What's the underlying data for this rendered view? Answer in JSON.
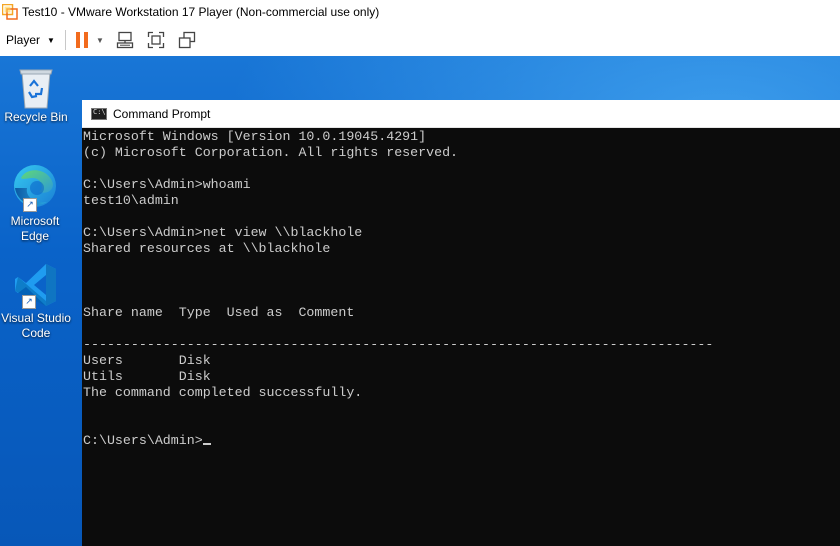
{
  "vmware": {
    "window_title": "Test10 - VMware Workstation 17 Player (Non-commercial use only)",
    "player_menu_label": "Player",
    "icons": [
      "vmware-logo-icon",
      "pause-icon",
      "send-ctrl-alt-del-icon",
      "fullscreen-icon",
      "unity-icon"
    ],
    "accent_color": "#f26b1d"
  },
  "desktop": {
    "icons": [
      {
        "label": "Recycle Bin",
        "icon": "recycle-bin-icon"
      },
      {
        "label": "Microsoft Edge",
        "icon": "edge-icon"
      },
      {
        "label": "Visual Studio Code",
        "icon": "vscode-icon"
      }
    ]
  },
  "cmd": {
    "title": "Command Prompt",
    "lines": [
      "Microsoft Windows [Version 10.0.19045.4291]",
      "(c) Microsoft Corporation. All rights reserved.",
      "",
      "C:\\Users\\Admin>whoami",
      "test10\\admin",
      "",
      "C:\\Users\\Admin>net view \\\\blackhole",
      "Shared resources at \\\\blackhole",
      "",
      "",
      "",
      "Share name  Type  Used as  Comment",
      "",
      "-------------------------------------------------------------------------------",
      "Users       Disk",
      "Utils       Disk",
      "The command completed successfully.",
      "",
      "",
      "C:\\Users\\Admin>"
    ]
  }
}
